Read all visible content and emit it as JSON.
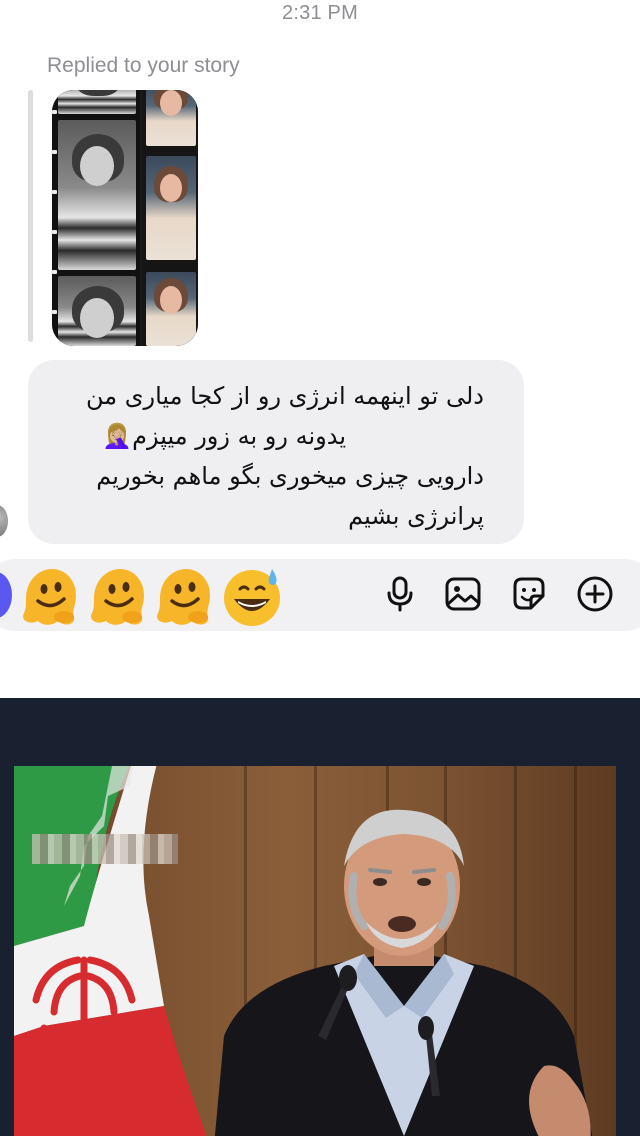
{
  "chat": {
    "timestamp": "2:31 PM",
    "reply_label": "Replied to your story",
    "message_lines": [
      "دلی تو اینهمه انرژی رو از کجا میاری من",
      "یدونه رو به زور میپزم🤦🏼‍♀️",
      "دارویی چیزی میخوری بگو ماهم بخوریم",
      "پرانرژی بشیم"
    ],
    "bubble_color": "#efeff2",
    "text_color": "#111111"
  },
  "composer": {
    "emojis": [
      "melting-face-emoji",
      "melting-face-emoji",
      "melting-face-emoji",
      "grinning-sweat-emoji"
    ],
    "tools": [
      "microphone-icon",
      "image-icon",
      "sticker-icon",
      "add-icon"
    ],
    "camera_button_color": "#5b58f2"
  },
  "video": {
    "background": "#192130"
  }
}
